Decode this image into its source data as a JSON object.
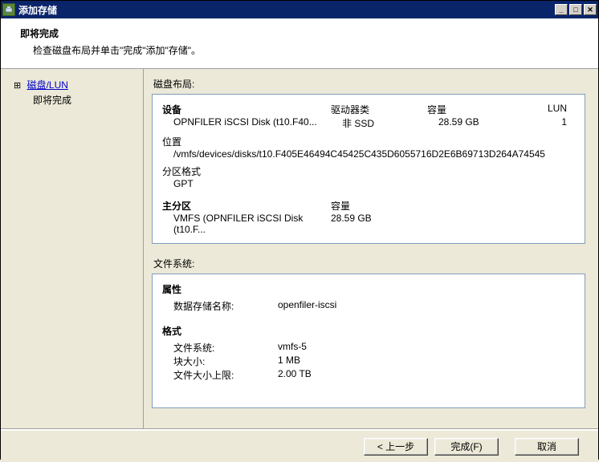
{
  "window": {
    "title": "添加存储"
  },
  "header": {
    "title": "即将完成",
    "description": "检查磁盘布局并单击\"完成\"添加\"存储\"。"
  },
  "sidebar": {
    "items": [
      {
        "label": "磁盘/LUN",
        "link": true
      },
      {
        "label": "即将完成",
        "link": false
      }
    ]
  },
  "disk_layout": {
    "label": "磁盘布局:",
    "device": {
      "headers": {
        "device": "设备",
        "drive_type": "驱动器类",
        "capacity": "容量",
        "lun": "LUN"
      },
      "row": {
        "device": "OPNFILER iSCSI Disk (t10.F40...",
        "drive_type": "非 SSD",
        "capacity": "28.59 GB",
        "lun": "1"
      }
    },
    "location": {
      "label": "位置",
      "value": "/vmfs/devices/disks/t10.F405E46494C45425C435D6055716D2E6B69713D264A74545"
    },
    "partition_format": {
      "label": "分区格式",
      "value": "GPT"
    },
    "primary_partition": {
      "headers": {
        "name": "主分区",
        "capacity": "容量"
      },
      "row": {
        "name": "VMFS (OPNFILER iSCSI Disk (t10.F...",
        "capacity": "28.59 GB"
      }
    }
  },
  "filesystem": {
    "label": "文件系统:",
    "properties": {
      "label": "属性",
      "datastore_name_label": "数据存储名称:",
      "datastore_name_value": "openfiler-iscsi"
    },
    "format": {
      "label": "格式",
      "rows": [
        {
          "k": "文件系统:",
          "v": "vmfs-5"
        },
        {
          "k": "块大小:",
          "v": "1 MB"
        },
        {
          "k": "文件大小上限:",
          "v": "2.00 TB"
        }
      ]
    }
  },
  "buttons": {
    "back": "< 上一步",
    "finish": "完成(F)",
    "cancel": "取消"
  }
}
